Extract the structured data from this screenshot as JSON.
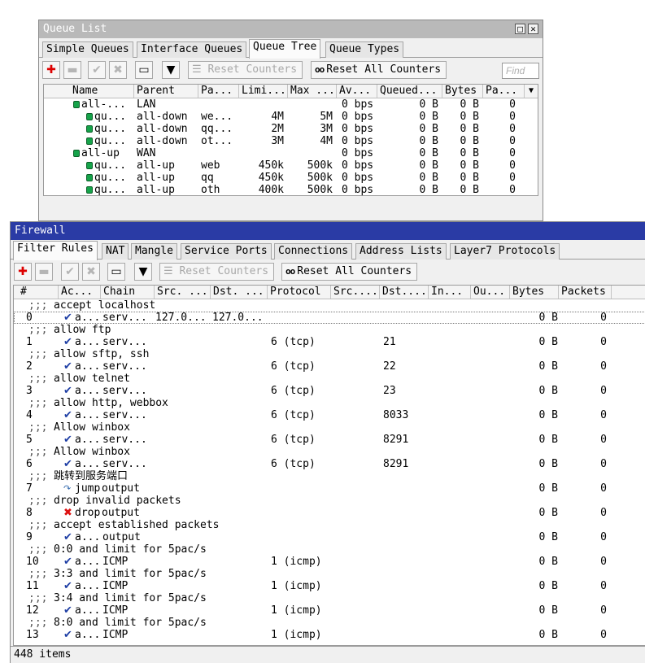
{
  "queue_window": {
    "title": "Queue List",
    "tabs": [
      "Simple Queues",
      "Interface Queues",
      "Queue Tree",
      "Queue Types"
    ],
    "selected_tab": "Queue Tree",
    "toolbar": {
      "reset_counters": "Reset Counters",
      "reset_all_counters": "Reset All Counters",
      "find_placeholder": "Find"
    },
    "columns": [
      "Name",
      "Parent",
      "Pa...",
      "Limi...",
      "Max ...",
      "Av...",
      "Queued...",
      "Bytes",
      "Pa..."
    ],
    "rows": [
      {
        "name": "all-...",
        "parent": "LAN",
        "packet_mark": "",
        "limit_at": "",
        "max_limit": "",
        "avg_rate": "0 bps",
        "queued": "0 B",
        "bytes": "0 B",
        "packets": "0",
        "level": 0
      },
      {
        "name": "qu...",
        "parent": "all-down",
        "packet_mark": "we...",
        "limit_at": "4M",
        "max_limit": "5M",
        "avg_rate": "0 bps",
        "queued": "0 B",
        "bytes": "0 B",
        "packets": "0",
        "level": 1
      },
      {
        "name": "qu...",
        "parent": "all-down",
        "packet_mark": "qq...",
        "limit_at": "2M",
        "max_limit": "3M",
        "avg_rate": "0 bps",
        "queued": "0 B",
        "bytes": "0 B",
        "packets": "0",
        "level": 1
      },
      {
        "name": "qu...",
        "parent": "all-down",
        "packet_mark": "ot...",
        "limit_at": "3M",
        "max_limit": "4M",
        "avg_rate": "0 bps",
        "queued": "0 B",
        "bytes": "0 B",
        "packets": "0",
        "level": 1
      },
      {
        "name": "all-up",
        "parent": "WAN",
        "packet_mark": "",
        "limit_at": "",
        "max_limit": "",
        "avg_rate": "0 bps",
        "queued": "0 B",
        "bytes": "0 B",
        "packets": "0",
        "level": 0
      },
      {
        "name": "qu...",
        "parent": "all-up",
        "packet_mark": "web",
        "limit_at": "450k",
        "max_limit": "500k",
        "avg_rate": "0 bps",
        "queued": "0 B",
        "bytes": "0 B",
        "packets": "0",
        "level": 1
      },
      {
        "name": "qu...",
        "parent": "all-up",
        "packet_mark": "qq",
        "limit_at": "450k",
        "max_limit": "500k",
        "avg_rate": "0 bps",
        "queued": "0 B",
        "bytes": "0 B",
        "packets": "0",
        "level": 1
      },
      {
        "name": "qu...",
        "parent": "all-up",
        "packet_mark": "oth",
        "limit_at": "400k",
        "max_limit": "500k",
        "avg_rate": "0 bps",
        "queued": "0 B",
        "bytes": "0 B",
        "packets": "0",
        "level": 1
      }
    ]
  },
  "firewall_window": {
    "title": "Firewall",
    "tabs": [
      "Filter Rules",
      "NAT",
      "Mangle",
      "Service Ports",
      "Connections",
      "Address Lists",
      "Layer7 Protocols"
    ],
    "selected_tab": "Filter Rules",
    "toolbar": {
      "reset_counters": "Reset Counters",
      "reset_all_counters": "Reset All Counters"
    },
    "columns": [
      "#",
      "Ac...",
      "Chain",
      "Src. ...",
      "Dst. ...",
      "Protocol",
      "Src....",
      "Dst....",
      "In...",
      "Ou...",
      "Bytes",
      "Packets"
    ],
    "comment_prefix": ";;;",
    "rules": [
      {
        "comment": "accept localhost",
        "num": "0",
        "icon": "accept",
        "action": "a...",
        "chain": "serv...",
        "src": "127.0...",
        "dst": "127.0...",
        "protocol": "",
        "dst_port": "",
        "bytes": "0 B",
        "packets": "0"
      },
      {
        "comment": "allow ftp",
        "num": "1",
        "icon": "accept",
        "action": "a...",
        "chain": "serv...",
        "src": "",
        "dst": "",
        "protocol": "6 (tcp)",
        "dst_port": "21",
        "bytes": "0 B",
        "packets": "0"
      },
      {
        "comment": "allow sftp, ssh",
        "num": "2",
        "icon": "accept",
        "action": "a...",
        "chain": "serv...",
        "src": "",
        "dst": "",
        "protocol": "6 (tcp)",
        "dst_port": "22",
        "bytes": "0 B",
        "packets": "0"
      },
      {
        "comment": "allow telnet",
        "num": "3",
        "icon": "accept",
        "action": "a...",
        "chain": "serv...",
        "src": "",
        "dst": "",
        "protocol": "6 (tcp)",
        "dst_port": "23",
        "bytes": "0 B",
        "packets": "0"
      },
      {
        "comment": "allow http, webbox",
        "num": "4",
        "icon": "accept",
        "action": "a...",
        "chain": "serv...",
        "src": "",
        "dst": "",
        "protocol": "6 (tcp)",
        "dst_port": "8033",
        "bytes": "0 B",
        "packets": "0"
      },
      {
        "comment": "Allow winbox",
        "num": "5",
        "icon": "accept",
        "action": "a...",
        "chain": "serv...",
        "src": "",
        "dst": "",
        "protocol": "6 (tcp)",
        "dst_port": "8291",
        "bytes": "0 B",
        "packets": "0"
      },
      {
        "comment": "Allow winbox",
        "num": "6",
        "icon": "accept",
        "action": "a...",
        "chain": "serv...",
        "src": "",
        "dst": "",
        "protocol": "6 (tcp)",
        "dst_port": "8291",
        "bytes": "0 B",
        "packets": "0"
      },
      {
        "comment": "跳转到服务端口",
        "num": "7",
        "icon": "jump",
        "action": "jump",
        "chain": "output",
        "src": "",
        "dst": "",
        "protocol": "",
        "dst_port": "",
        "bytes": "0 B",
        "packets": "0"
      },
      {
        "comment": "drop invalid packets",
        "num": "8",
        "icon": "drop",
        "action": "drop",
        "chain": "output",
        "src": "",
        "dst": "",
        "protocol": "",
        "dst_port": "",
        "bytes": "0 B",
        "packets": "0"
      },
      {
        "comment": "accept established packets",
        "num": "9",
        "icon": "accept",
        "action": "a...",
        "chain": "output",
        "src": "",
        "dst": "",
        "protocol": "",
        "dst_port": "",
        "bytes": "0 B",
        "packets": "0"
      },
      {
        "comment": "0:0 and limit for 5pac/s",
        "num": "10",
        "icon": "accept",
        "action": "a...",
        "chain": "ICMP",
        "src": "",
        "dst": "",
        "protocol": "1 (icmp)",
        "dst_port": "",
        "bytes": "0 B",
        "packets": "0"
      },
      {
        "comment": "3:3 and limit for 5pac/s",
        "num": "11",
        "icon": "accept",
        "action": "a...",
        "chain": "ICMP",
        "src": "",
        "dst": "",
        "protocol": "1 (icmp)",
        "dst_port": "",
        "bytes": "0 B",
        "packets": "0"
      },
      {
        "comment": "3:4 and limit for 5pac/s",
        "num": "12",
        "icon": "accept",
        "action": "a...",
        "chain": "ICMP",
        "src": "",
        "dst": "",
        "protocol": "1 (icmp)",
        "dst_port": "",
        "bytes": "0 B",
        "packets": "0"
      },
      {
        "comment": "8:0 and limit for 5pac/s",
        "num": "13",
        "icon": "accept",
        "action": "a...",
        "chain": "ICMP",
        "src": "",
        "dst": "",
        "protocol": "1 (icmp)",
        "dst_port": "",
        "bytes": "0 B",
        "packets": "0"
      }
    ],
    "status": "448 items"
  }
}
